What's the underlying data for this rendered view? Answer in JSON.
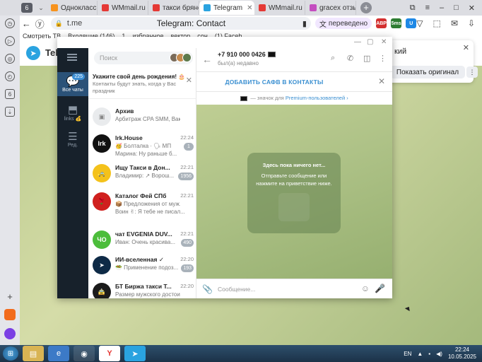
{
  "browser": {
    "tab_counter": "6",
    "tabs": [
      {
        "label": "Одноклассн",
        "color": "#f7931e"
      },
      {
        "label": "WMmail.ru -",
        "color": "#e53935"
      },
      {
        "label": "такси брянс",
        "color": "#e53935"
      },
      {
        "label": "Telegram",
        "color": "#2aa3e0",
        "active": true
      },
      {
        "label": "WMmail.ru -",
        "color": "#e53935"
      },
      {
        "label": "gracex отзыв",
        "color": "#c44ec0"
      }
    ],
    "address": {
      "domain": "t.me",
      "page_title": "Telegram: Contact",
      "translated": "переведено"
    },
    "extensions": [
      {
        "label": "ABP",
        "color": "#d32f2f"
      },
      {
        "label": "5ms",
        "color": "#2e7d32"
      },
      {
        "label": "U",
        "color": "#1e88e5"
      }
    ],
    "bookmarks": [
      "Смотреть ТВ",
      "Входящие (146)",
      "1",
      "избранное",
      "вектор",
      "сон",
      "(1) Faceb"
    ]
  },
  "page": {
    "brand": "Telegram",
    "translate_popup": {
      "title": "кий",
      "show_original": "Показать оригинал"
    }
  },
  "telegram": {
    "folders": [
      {
        "label": "Все чаты",
        "badge": "225",
        "active": true
      },
      {
        "label": "links 💰"
      },
      {
        "label": "Ред."
      }
    ],
    "search_placeholder": "Поиск",
    "birthday": {
      "title": "Укажите свой день рождения! 🎂",
      "subtitle": "Контакты будут знать, когда у Вас праздник"
    },
    "chats": [
      {
        "name": "Архив",
        "preview": "Арбитраж CPA SMM, Ваканс...",
        "time": "",
        "badge": "",
        "avatar_color": "#e9ebed",
        "avatar_text": "▣"
      },
      {
        "name": "Irk.House",
        "preview": "🥳 Болталка · 🗣 МП",
        "preview2": "Марина: Ну раньше б...",
        "time": "22:24",
        "badge": "1",
        "avatar_color": "#111111",
        "avatar_text": "Irk"
      },
      {
        "name": "Ищу Такси в Дон...",
        "preview": "Владимир: ↗ Ворош...",
        "time": "22:21",
        "badge": "1956",
        "avatar_color": "#f4c21b",
        "avatar_text": "🚕"
      },
      {
        "name": "Каталог Фей СПб",
        "preview": "📦 Предложения от муж...",
        "preview2": "Воин ✌: Я тебе не писал...",
        "time": "22:21",
        "badge": "",
        "avatar_color": "#d0201e",
        "avatar_text": "🌹"
      },
      {
        "name": "чат EVGENIA DUV...",
        "preview": "Иван: Очень красива...",
        "time": "22:21",
        "badge": "490",
        "avatar_color": "#4cbd3b",
        "avatar_text": "ЧО"
      },
      {
        "name": "ИИ-вселенная ✓",
        "preview": "🥗 Применение подоз...",
        "time": "22:20",
        "badge": "193",
        "avatar_color": "#0e2a46",
        "avatar_text": "➤"
      },
      {
        "name": "БТ Биржа такси Т...",
        "preview": "Размер мужского достоинс...",
        "time": "22:20",
        "badge": "",
        "avatar_color": "#1b1b1b",
        "avatar_text": "🚖"
      }
    ],
    "contact": {
      "phone": "+7 910 000 0426",
      "status": "был(а) недавно"
    },
    "add_contact": "ДОБАВИТЬ САФВ В КОНТАКТЫ",
    "premium_text": "— значок для",
    "premium_link": "Premium-пользователей ›",
    "empty": {
      "title": "Здесь пока ничего нет...",
      "text": "Отправьте сообщение или нажмите на приветствие ниже."
    },
    "composer_placeholder": "Сообщение..."
  },
  "taskbar": {
    "lang": "EN",
    "time": "22:24",
    "date": "10.05.2025"
  }
}
